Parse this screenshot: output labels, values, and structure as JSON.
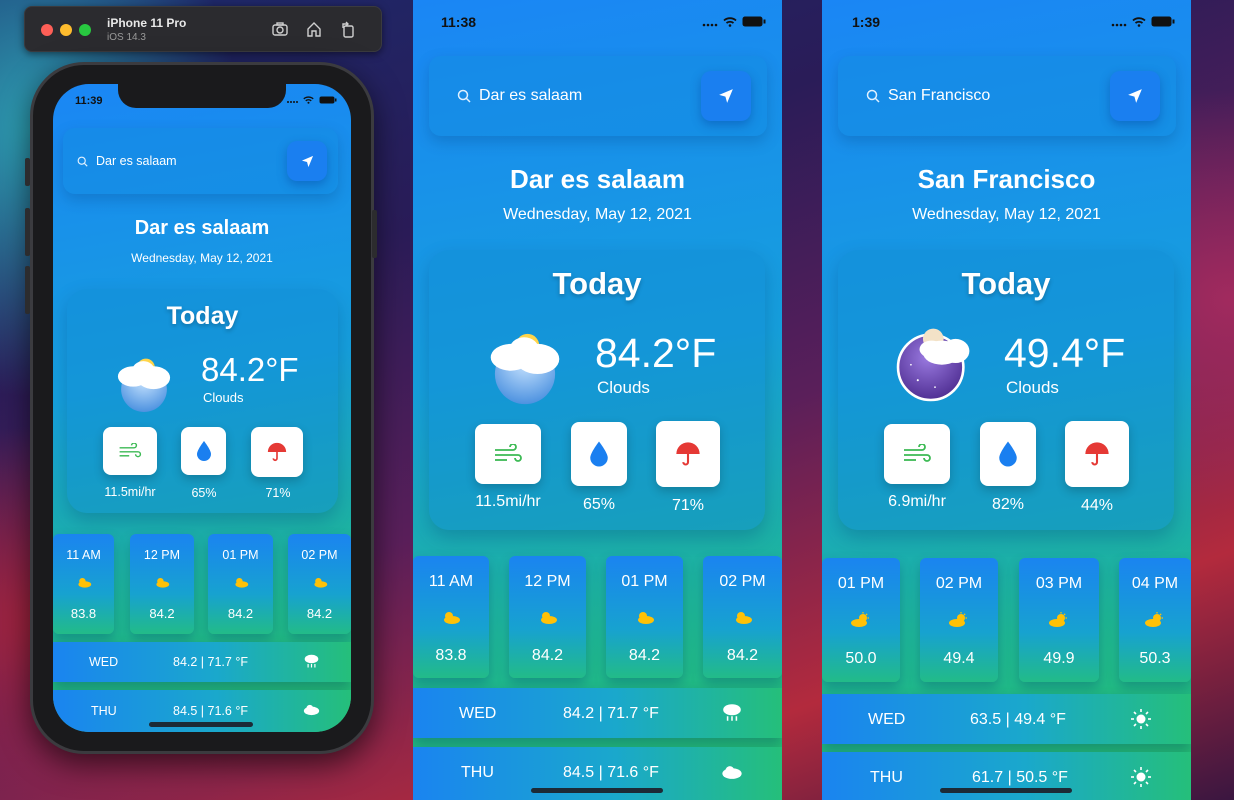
{
  "simulator": {
    "device": "iPhone 11 Pro",
    "os": "iOS 14.3",
    "tools": [
      "screenshot-icon",
      "home-icon",
      "rotate-icon"
    ]
  },
  "colors": {
    "accent": "#1a7ff0",
    "gradient_top": "#1a86f5",
    "gradient_bottom": "#28c46a",
    "wind_icon": "#3cba54",
    "humidity_icon": "#1a7ff0",
    "rain_icon": "#e53935",
    "sun_icon": "#ffc107"
  },
  "screens": [
    {
      "status_time": "11:39",
      "search_value": "Dar es  salaam",
      "city": "Dar es  salaam",
      "date": "Wednesday, May 12, 2021",
      "today_label": "Today",
      "temperature": "84.2°F",
      "condition": "Clouds",
      "icon": "cloudy-day-icon",
      "wind": "11.5mi/hr",
      "humidity": "65%",
      "rain": "71%",
      "hourly": [
        {
          "time": "11 AM",
          "temp": "83.8"
        },
        {
          "time": "12 PM",
          "temp": "84.2"
        },
        {
          "time": "01 PM",
          "temp": "84.2"
        },
        {
          "time": "02 PM",
          "temp": "84.2"
        }
      ],
      "daily": [
        {
          "day": "WED",
          "range": "84.2 | 71.7 °F",
          "icon": "rain-cloud-icon"
        },
        {
          "day": "THU",
          "range": "84.5 | 71.6 °F",
          "icon": "cloud-icon"
        }
      ]
    },
    {
      "status_time": "11:38",
      "search_value": "Dar es  salaam",
      "city": "Dar es  salaam",
      "date": "Wednesday, May 12, 2021",
      "today_label": "Today",
      "temperature": "84.2°F",
      "condition": "Clouds",
      "icon": "cloudy-day-icon",
      "wind": "11.5mi/hr",
      "humidity": "65%",
      "rain": "71%",
      "hourly": [
        {
          "time": "11 AM",
          "temp": "83.8"
        },
        {
          "time": "12 PM",
          "temp": "84.2"
        },
        {
          "time": "01 PM",
          "temp": "84.2"
        },
        {
          "time": "02 PM",
          "temp": "84.2"
        }
      ],
      "daily": [
        {
          "day": "WED",
          "range": "84.2 | 71.7 °F",
          "icon": "rain-cloud-icon"
        },
        {
          "day": "THU",
          "range": "84.5 | 71.6 °F",
          "icon": "cloud-icon"
        }
      ]
    },
    {
      "status_time": "1:39",
      "search_value": "San Francisco",
      "city": "San Francisco",
      "date": "Wednesday, May 12, 2021",
      "today_label": "Today",
      "temperature": "49.4°F",
      "condition": "Clouds",
      "icon": "cloudy-night-icon",
      "wind": "6.9mi/hr",
      "humidity": "82%",
      "rain": "44%",
      "hourly": [
        {
          "time": "01 PM",
          "temp": "50.0"
        },
        {
          "time": "02 PM",
          "temp": "49.4"
        },
        {
          "time": "03 PM",
          "temp": "49.9"
        },
        {
          "time": "04 PM",
          "temp": "50.3"
        }
      ],
      "daily": [
        {
          "day": "WED",
          "range": "63.5 | 49.4 °F",
          "icon": "sun-icon"
        },
        {
          "day": "THU",
          "range": "61.7 | 50.5 °F",
          "icon": "sun-icon"
        }
      ]
    }
  ]
}
